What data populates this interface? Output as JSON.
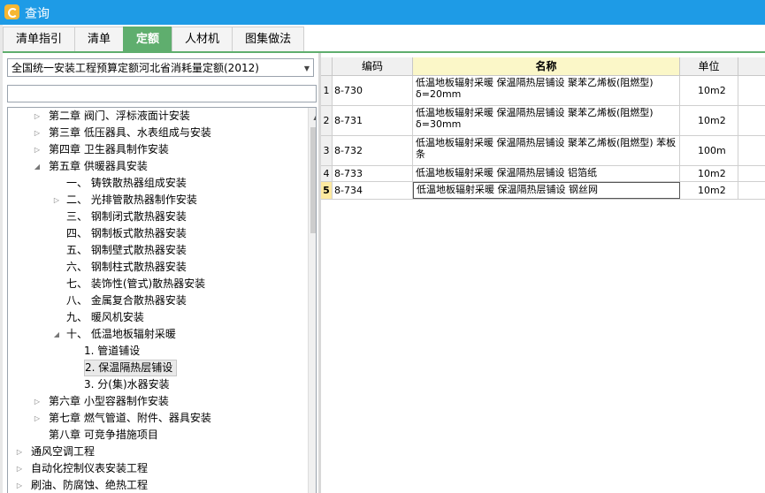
{
  "window": {
    "title": "查询"
  },
  "tabs": [
    {
      "label": "清单指引",
      "active": false
    },
    {
      "label": "清单",
      "active": false
    },
    {
      "label": "定额",
      "active": true
    },
    {
      "label": "人材机",
      "active": false
    },
    {
      "label": "图集做法",
      "active": false
    }
  ],
  "library_select": {
    "value": "全国统一安装工程预算定额河北省消耗量定额(2012)"
  },
  "filter": {
    "value": ""
  },
  "tree": [
    {
      "label": "第二章 阀门、浮标液面计安装",
      "expander": "collapsed"
    },
    {
      "label": "第三章 低压器具、水表组成与安装",
      "expander": "collapsed"
    },
    {
      "label": "第四章 卫生器具制作安装",
      "expander": "collapsed"
    },
    {
      "label": "第五章 供暖器具安装",
      "expander": "expanded"
    },
    {
      "label": "一、 铸铁散热器组成安装",
      "expander": "none"
    },
    {
      "label": "二、 光排管散热器制作安装",
      "expander": "collapsed"
    },
    {
      "label": "三、 钢制闭式散热器安装",
      "expander": "none"
    },
    {
      "label": "四、 钢制板式散热器安装",
      "expander": "none"
    },
    {
      "label": "五、 钢制壁式散热器安装",
      "expander": "none"
    },
    {
      "label": "六、 钢制柱式散热器安装",
      "expander": "none"
    },
    {
      "label": "七、 装饰性(管式)散热器安装",
      "expander": "none"
    },
    {
      "label": "八、 金属复合散热器安装",
      "expander": "none"
    },
    {
      "label": "九、 暖风机安装",
      "expander": "none"
    },
    {
      "label": "十、 低温地板辐射采暖",
      "expander": "expanded"
    },
    {
      "label": "1. 管道铺设",
      "expander": "none"
    },
    {
      "label": "2. 保温隔热层铺设",
      "expander": "none",
      "selected": true
    },
    {
      "label": "3. 分(集)水器安装",
      "expander": "none"
    },
    {
      "label": "第六章 小型容器制作安装",
      "expander": "collapsed"
    },
    {
      "label": "第七章 燃气管道、附件、器具安装",
      "expander": "collapsed"
    },
    {
      "label": "第八章 可竞争措施项目",
      "expander": "none"
    },
    {
      "label": "通风空调工程",
      "expander": "collapsed"
    },
    {
      "label": "自动化控制仪表安装工程",
      "expander": "collapsed"
    },
    {
      "label": "刷油、防腐蚀、绝热工程",
      "expander": "collapsed"
    }
  ],
  "grid": {
    "headers": {
      "code": "编码",
      "name": "名称",
      "unit": "单位"
    },
    "rows": [
      {
        "index": "1",
        "code": "8-730",
        "name": "低温地板辐射采暖 保温隔热层铺设 聚苯乙烯板(阻燃型) δ=20mm",
        "unit": "10m2"
      },
      {
        "index": "2",
        "code": "8-731",
        "name": "低温地板辐射采暖 保温隔热层铺设 聚苯乙烯板(阻燃型) δ=30mm",
        "unit": "10m2"
      },
      {
        "index": "3",
        "code": "8-732",
        "name": "低温地板辐射采暖 保温隔热层铺设 聚苯乙烯板(阻燃型) 苯板条",
        "unit": "100m"
      },
      {
        "index": "4",
        "code": "8-733",
        "name": "低温地板辐射采暖 保温隔热层铺设 铝箔纸",
        "unit": "10m2"
      },
      {
        "index": "5",
        "code": "8-734",
        "name": "低温地板辐射采暖 保温隔热层铺设 钢丝网",
        "unit": "10m2",
        "current": true
      }
    ]
  },
  "colors": {
    "titlebar": "#1e9be6",
    "active_tab": "#5fae6e",
    "name_header": "#fbf7c8"
  }
}
